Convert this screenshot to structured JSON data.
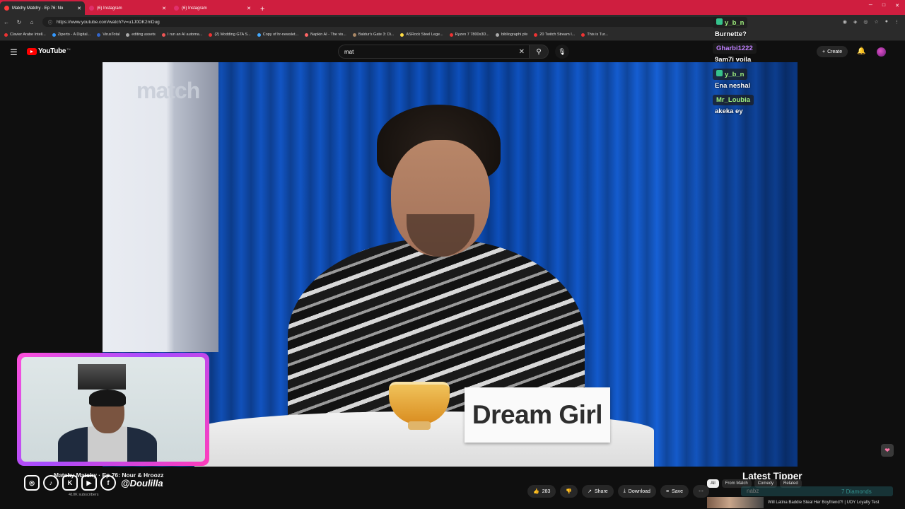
{
  "browser": {
    "tabs": [
      {
        "label": "Matchy Matchy · Ep 76: No",
        "active": true,
        "color": "#ff3b3b"
      },
      {
        "label": "(6) Instagram",
        "active": false,
        "color": "#e1306c"
      },
      {
        "label": "(6) Instagram",
        "active": false,
        "color": "#e1306c"
      }
    ],
    "new_tab": "+",
    "url": "https://www.youtube.com/watch?v=u1J0DK2mDug",
    "bookmarks": [
      {
        "label": "Clavier Arabe Intell...",
        "color": "#e33"
      },
      {
        "label": "Ziperto - A Digital...",
        "color": "#39f"
      },
      {
        "label": "VirusTotal",
        "color": "#36c"
      },
      {
        "label": "editing assets",
        "color": "#aaa"
      },
      {
        "label": "I run an AI automa...",
        "color": "#e55"
      },
      {
        "label": "(2) Modding GTA S...",
        "color": "#e33"
      },
      {
        "label": "Copy of hr-newslet...",
        "color": "#4af"
      },
      {
        "label": "Napkin AI - The vis...",
        "color": "#f66"
      },
      {
        "label": "Baldur's Gate 3: Di...",
        "color": "#a86"
      },
      {
        "label": "ASRock Steel Lege...",
        "color": "#fd4"
      },
      {
        "label": "Ryzen 7 7800x3D...",
        "color": "#e33"
      },
      {
        "label": "bibliographi pfe",
        "color": "#aaa"
      },
      {
        "label": "20 Twitch Stream I...",
        "color": "#e33"
      },
      {
        "label": "This is Tur...",
        "color": "#e33"
      }
    ]
  },
  "youtube": {
    "logo_text": "YouTube",
    "logo_tm": "TN",
    "search_value": "mat",
    "create_label": "Create"
  },
  "video": {
    "name_card": "Dream Girl",
    "brand_mark": "match"
  },
  "chat": [
    {
      "user": "y_b_n",
      "color": "#9ff07e",
      "badge": true,
      "message": "Burnette?"
    },
    {
      "user": "Gharbi1222",
      "color": "#c080ff",
      "badge": false,
      "message": "9am7i voila"
    },
    {
      "user": "y_b_n",
      "color": "#9ff07e",
      "badge": true,
      "message": "Ena neshal"
    },
    {
      "user": "Mr_Loubia",
      "color": "#9ff07e",
      "badge": false,
      "message": "akeka ey"
    }
  ],
  "bottom": {
    "title": "Matchy Matchy · Ep 76: Nour & Hroozz",
    "handle": "@Doulilla",
    "subs": "410K subscribers",
    "latest_tipper": "Latest Tipper",
    "tipper_name": "nabz",
    "diamonds": "7 Diamonds",
    "actions": {
      "likes": "283",
      "share": "Share",
      "download": "Download",
      "save": "Save"
    },
    "chips": [
      "All",
      "From Match",
      "Comedy",
      "Related"
    ],
    "rec_title": "Will Latina Baddie Steal Her Boyfriend?! | UDY Loyalty Test"
  }
}
